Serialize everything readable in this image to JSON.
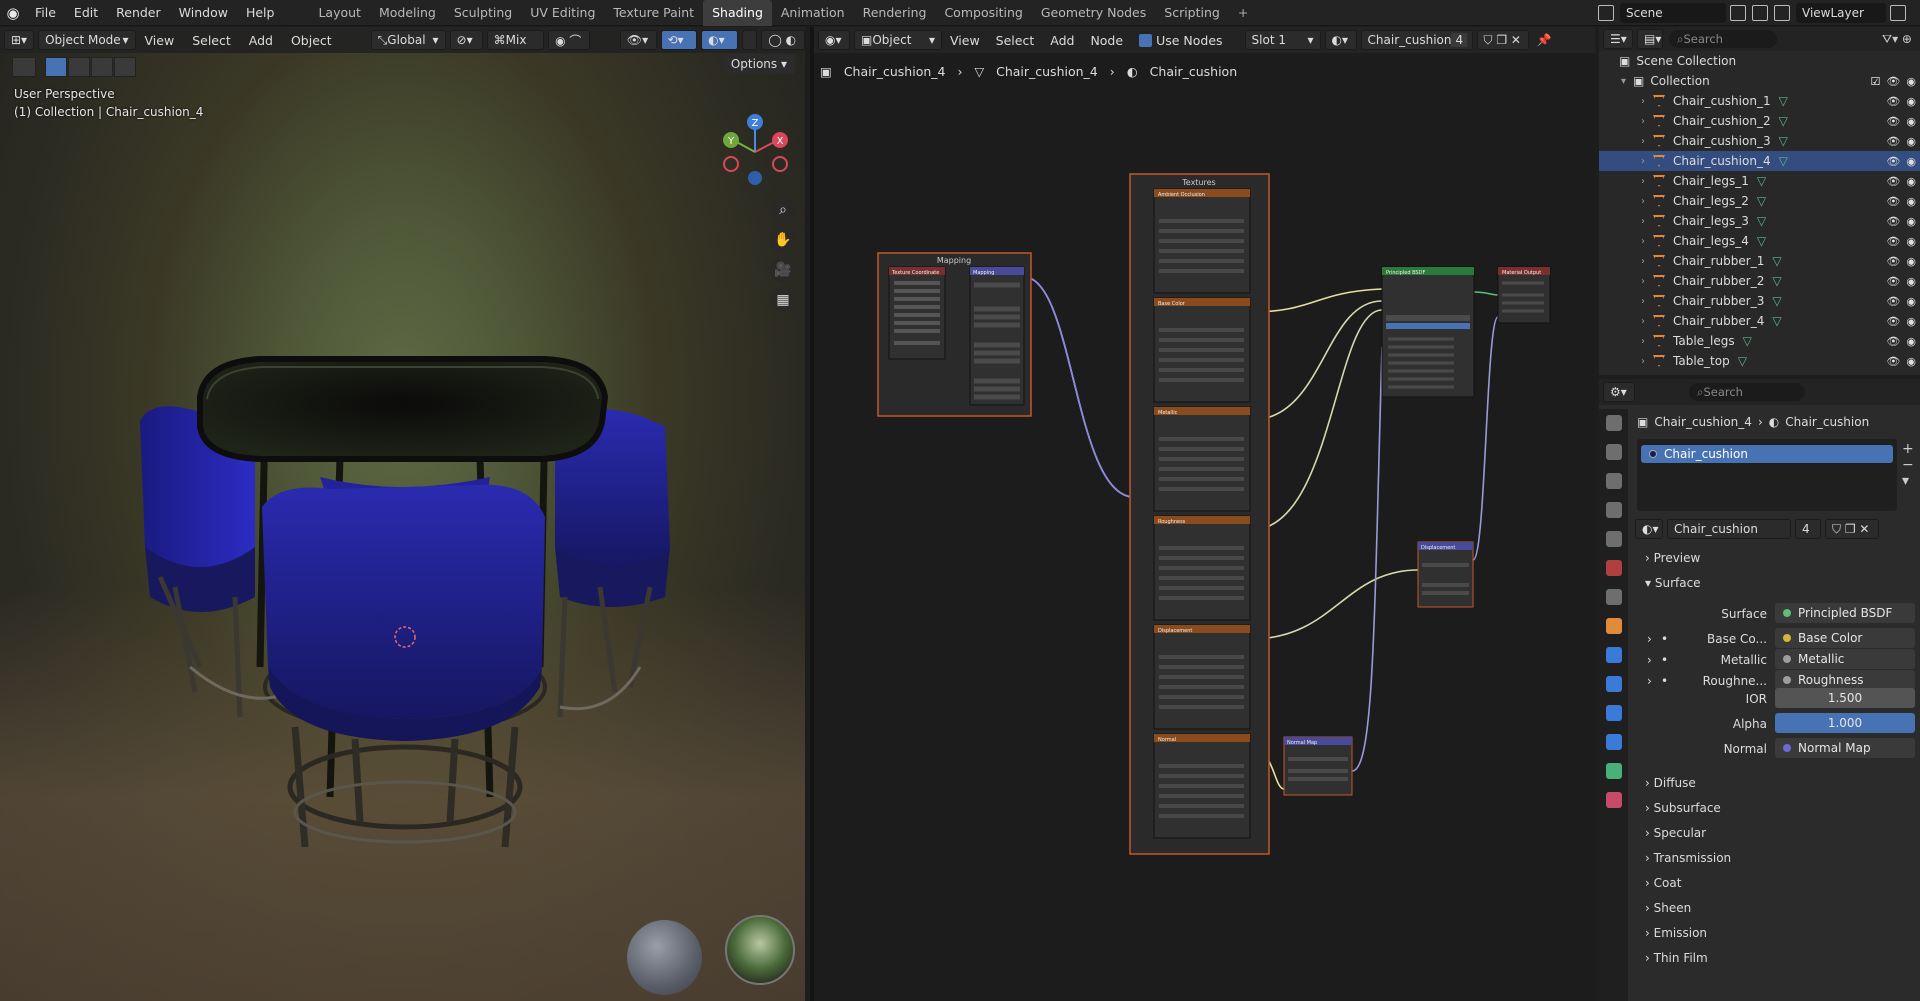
{
  "topbar": {
    "menus": [
      "File",
      "Edit",
      "Render",
      "Window",
      "Help"
    ],
    "workspaces": [
      "Layout",
      "Modeling",
      "Sculpting",
      "UV Editing",
      "Texture Paint",
      "Shading",
      "Animation",
      "Rendering",
      "Compositing",
      "Geometry Nodes",
      "Scripting"
    ],
    "active_workspace": "Shading",
    "plus": "+",
    "scene": "Scene",
    "view_layer": "ViewLayer"
  },
  "viewport": {
    "mode": "Object Mode",
    "menus": [
      "View",
      "Select",
      "Add",
      "Object"
    ],
    "orientation": "Global",
    "pivot": "Mix",
    "options": "Options",
    "overlay_line1": "User Perspective",
    "overlay_line2": "(1) Collection | Chair_cushion_4",
    "gizmo": {
      "x": "X",
      "y": "Y",
      "z": "Z"
    }
  },
  "node_editor": {
    "object_dropdown": "Object",
    "menus": [
      "View",
      "Select",
      "Add",
      "Node"
    ],
    "use_nodes_label": "Use Nodes",
    "slot": "Slot 1",
    "material": "Chair_cushion",
    "users": "4",
    "breadcrumb": [
      "Chair_cushion_4",
      "Chair_cushion_4",
      "Chair_cushion"
    ],
    "frames": {
      "mapping": "Mapping",
      "textures": "Textures"
    },
    "nodes": {
      "tex_coord": "Texture Coordinate",
      "mapping": "Mapping",
      "ao": "Ambient Occlusion",
      "base_color": "Base Color",
      "metallic": "Metallic",
      "roughness": "Roughness",
      "displacement_tex": "Displacement",
      "normal_tex": "Normal",
      "principled": "Principled BSDF",
      "material_output": "Material Output",
      "displacement": "Displacement",
      "normal_map": "Normal Map"
    }
  },
  "outliner": {
    "search_placeholder": "Search",
    "scene_collection": "Scene Collection",
    "collection": "Collection",
    "items": [
      "Chair_cushion_1",
      "Chair_cushion_2",
      "Chair_cushion_3",
      "Chair_cushion_4",
      "Chair_legs_1",
      "Chair_legs_2",
      "Chair_legs_3",
      "Chair_legs_4",
      "Chair_rubber_1",
      "Chair_rubber_2",
      "Chair_rubber_3",
      "Chair_rubber_4",
      "Table_legs",
      "Table_top"
    ],
    "selected": "Chair_cushion_4"
  },
  "properties": {
    "search_placeholder": "Search",
    "breadcrumb_object": "Chair_cushion_4",
    "breadcrumb_material": "Chair_cushion",
    "slot_name": "Chair_cushion",
    "material_name": "Chair_cushion",
    "users": "4",
    "sections": {
      "preview": "Preview",
      "surface": "Surface"
    },
    "surface_label": "Surface",
    "surface_value": "Principled BSDF",
    "inputs": [
      {
        "label": "Base Co...",
        "value": "Base Color",
        "color": "#d8b53a"
      },
      {
        "label": "Metallic",
        "value": "Metallic",
        "color": "#9e9e9e"
      },
      {
        "label": "Roughne...",
        "value": "Roughness",
        "color": "#9e9e9e"
      }
    ],
    "ior_label": "IOR",
    "ior_value": "1.500",
    "alpha_label": "Alpha",
    "alpha_value": "1.000",
    "normal_label": "Normal",
    "normal_value": "Normal Map",
    "subsections": [
      "Diffuse",
      "Subsurface",
      "Specular",
      "Transmission",
      "Coat",
      "Sheen",
      "Emission",
      "Thin Film"
    ]
  },
  "colors": {
    "accent": "#4772b3",
    "frame_border": "#c2582a",
    "texture_node_header": "#8a4b1d",
    "shader_header": "#2a7a3a",
    "vector_header": "#4a4a9a"
  }
}
